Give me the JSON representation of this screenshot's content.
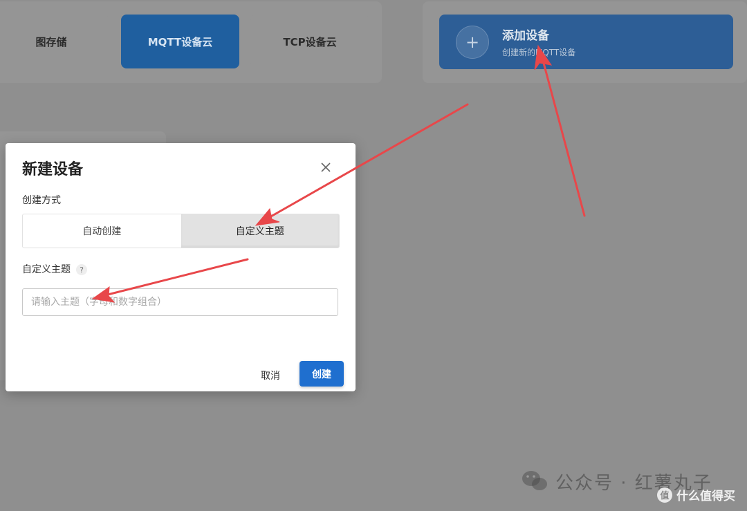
{
  "tabs": [
    {
      "label": "图存储",
      "active": false
    },
    {
      "label": "MQTT设备云",
      "active": true
    },
    {
      "label": "TCP设备云",
      "active": false
    }
  ],
  "add_device": {
    "title": "添加设备",
    "subtitle": "创建新的MQTT设备",
    "icon": "plus-icon"
  },
  "dialog": {
    "title": "新建设备",
    "method_label": "创建方式",
    "methods": [
      {
        "label": "自动创建",
        "selected": false
      },
      {
        "label": "自定义主题",
        "selected": true
      }
    ],
    "topic_label": "自定义主题",
    "help_glyph": "?",
    "topic_placeholder": "请输入主题（字母和数字组合）",
    "topic_value": "",
    "cancel_label": "取消",
    "create_label": "创建"
  },
  "watermark": {
    "text": "公众号 · 红薯丸子",
    "site": "什么值得买",
    "site_logo": "值"
  },
  "colors": {
    "primary": "#1f6fcf",
    "arrow": "#e8474a",
    "overlay": "#8f8f8f"
  }
}
